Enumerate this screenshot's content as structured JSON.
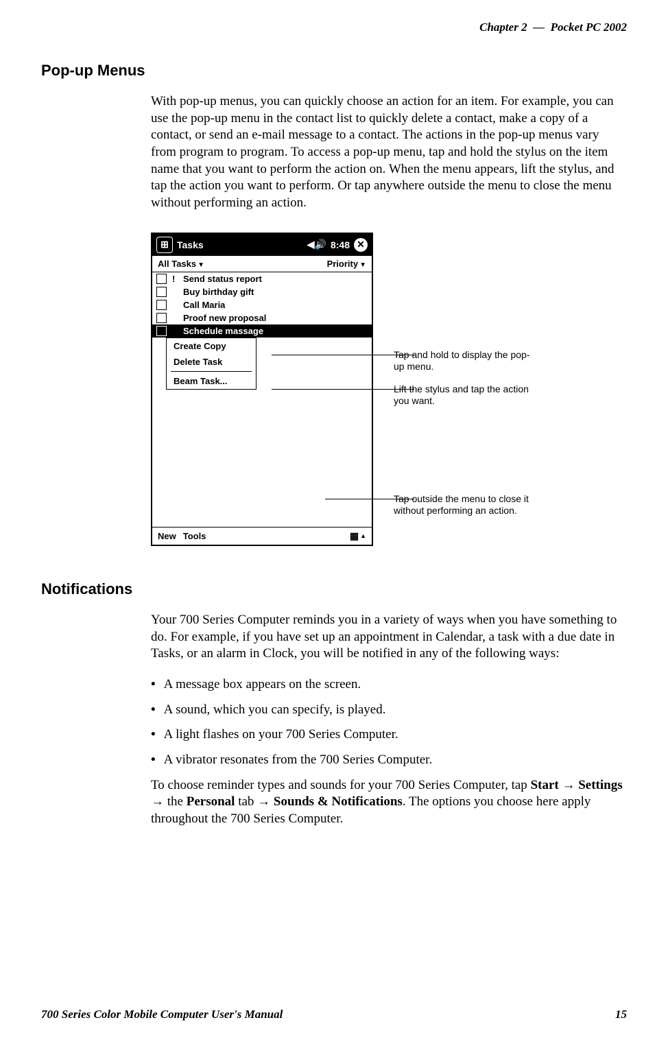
{
  "header": {
    "chapter": "Chapter  2",
    "separator": "—",
    "title": "Pocket PC 2002"
  },
  "section1": {
    "heading": "Pop-up Menus",
    "paragraph": "With pop-up menus, you can quickly choose an action for an item. For example, you can use the pop-up menu in the contact list to quickly delete a contact, make a copy of a contact, or send an e-mail message to a contact. The actions in the pop-up menus vary from program to program. To access a pop-up menu, tap and hold the stylus on the item name that you want to perform the action on. When the menu appears, lift the stylus, and tap the action you want to perform. Or tap anywhere outside the menu to close the menu without performing an action."
  },
  "device": {
    "title": "Tasks",
    "time": "8:48",
    "filter_left": "All Tasks",
    "filter_right": "Priority",
    "tasks": [
      {
        "priority": "!",
        "label": "Send status report"
      },
      {
        "priority": "",
        "label": "Buy birthday gift"
      },
      {
        "priority": "",
        "label": "Call Maria"
      },
      {
        "priority": "",
        "label": "Proof new proposal"
      },
      {
        "priority": "",
        "label": "Schedule massage",
        "selected": true
      }
    ],
    "popup": {
      "items": [
        "Create Copy",
        "Delete Task",
        "Beam Task..."
      ]
    },
    "bottombar": {
      "new": "New",
      "tools": "Tools"
    }
  },
  "callouts": {
    "c1": "Tap and hold to display the pop-up menu.",
    "c2": "Lift the stylus and tap the action you want.",
    "c3": "Tap outside the menu to close it without performing an action."
  },
  "section2": {
    "heading": "Notifications",
    "paragraph": "Your 700 Series Computer reminds you in a variety of ways when you have something to do. For example, if you have set up an appointment in Calendar, a task with a due date in Tasks, or an alarm in Clock, you will be notified in any of the following ways:",
    "bullets": [
      "A message box appears on the screen.",
      "A sound, which you can specify, is played.",
      "A light flashes on your 700 Series Computer.",
      "A vibrator resonates from the 700 Series Computer."
    ],
    "closing_pre": "To choose reminder types and sounds for your 700 Series Computer, tap ",
    "nav": {
      "start": "Start",
      "settings": "Settings",
      "the": " the ",
      "personal": "Personal",
      "tab": " tab ",
      "sounds": "Sounds & Notifications"
    },
    "closing_post": ". The options you choose here apply throughout the 700 Series Computer."
  },
  "footer": {
    "left": "700 Series Color Mobile Computer User's Manual",
    "right": "15"
  }
}
